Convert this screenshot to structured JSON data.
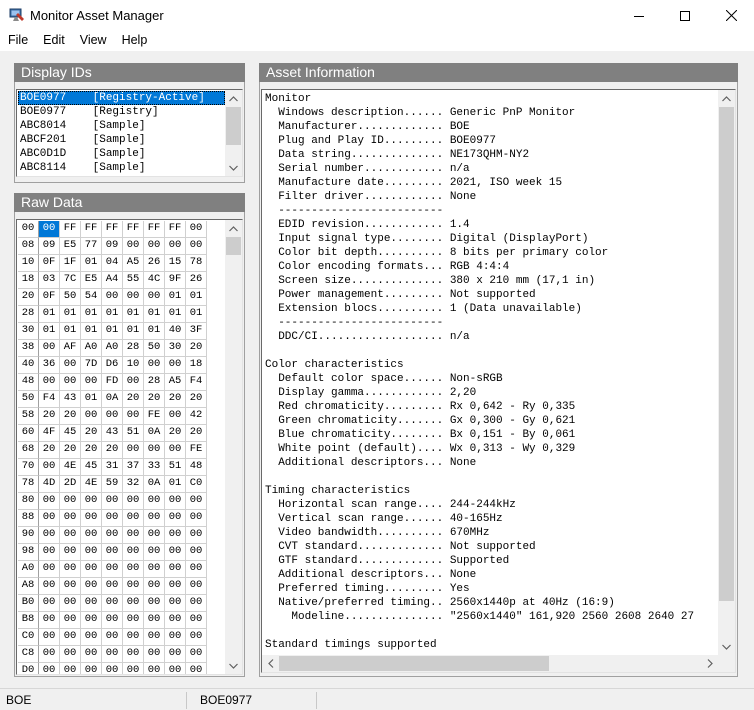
{
  "window": {
    "title": "Monitor Asset Manager",
    "icons": {
      "app": "monitor-app-icon",
      "minimize": "minimize-icon",
      "maximize": "maximize-icon",
      "close": "close-icon"
    }
  },
  "menu": [
    "File",
    "Edit",
    "View",
    "Help"
  ],
  "display_ids": {
    "title": "Display IDs",
    "items": [
      "BOE0977    [Registry-Active]",
      "BOE0977    [Registry]",
      "ABC8014    [Sample]",
      "ABCF201    [Sample]",
      "ABC0D1D    [Sample]",
      "ABC8114    [Sample]"
    ],
    "selected_index": 0
  },
  "raw_data": {
    "title": "Raw Data",
    "header": [
      "00",
      "00",
      "FF",
      "FF",
      "FF",
      "FF",
      "FF",
      "FF",
      "00"
    ],
    "rows": [
      [
        "08",
        "09",
        "E5",
        "77",
        "09",
        "00",
        "00",
        "00",
        "00"
      ],
      [
        "10",
        "0F",
        "1F",
        "01",
        "04",
        "A5",
        "26",
        "15",
        "78"
      ],
      [
        "18",
        "03",
        "7C",
        "E5",
        "A4",
        "55",
        "4C",
        "9F",
        "26"
      ],
      [
        "20",
        "0F",
        "50",
        "54",
        "00",
        "00",
        "00",
        "01",
        "01"
      ],
      [
        "28",
        "01",
        "01",
        "01",
        "01",
        "01",
        "01",
        "01",
        "01"
      ],
      [
        "30",
        "01",
        "01",
        "01",
        "01",
        "01",
        "01",
        "40",
        "3F"
      ],
      [
        "38",
        "00",
        "AF",
        "A0",
        "A0",
        "28",
        "50",
        "30",
        "20"
      ],
      [
        "40",
        "36",
        "00",
        "7D",
        "D6",
        "10",
        "00",
        "00",
        "18"
      ],
      [
        "48",
        "00",
        "00",
        "00",
        "FD",
        "00",
        "28",
        "A5",
        "F4"
      ],
      [
        "50",
        "F4",
        "43",
        "01",
        "0A",
        "20",
        "20",
        "20",
        "20"
      ],
      [
        "58",
        "20",
        "20",
        "00",
        "00",
        "00",
        "FE",
        "00",
        "42"
      ],
      [
        "60",
        "4F",
        "45",
        "20",
        "43",
        "51",
        "0A",
        "20",
        "20"
      ],
      [
        "68",
        "20",
        "20",
        "20",
        "20",
        "00",
        "00",
        "00",
        "FE"
      ],
      [
        "70",
        "00",
        "4E",
        "45",
        "31",
        "37",
        "33",
        "51",
        "48"
      ],
      [
        "78",
        "4D",
        "2D",
        "4E",
        "59",
        "32",
        "0A",
        "01",
        "C0"
      ],
      [
        "80",
        "00",
        "00",
        "00",
        "00",
        "00",
        "00",
        "00",
        "00"
      ],
      [
        "88",
        "00",
        "00",
        "00",
        "00",
        "00",
        "00",
        "00",
        "00"
      ],
      [
        "90",
        "00",
        "00",
        "00",
        "00",
        "00",
        "00",
        "00",
        "00"
      ],
      [
        "98",
        "00",
        "00",
        "00",
        "00",
        "00",
        "00",
        "00",
        "00"
      ],
      [
        "A0",
        "00",
        "00",
        "00",
        "00",
        "00",
        "00",
        "00",
        "00"
      ],
      [
        "A8",
        "00",
        "00",
        "00",
        "00",
        "00",
        "00",
        "00",
        "00"
      ],
      [
        "B0",
        "00",
        "00",
        "00",
        "00",
        "00",
        "00",
        "00",
        "00"
      ],
      [
        "B8",
        "00",
        "00",
        "00",
        "00",
        "00",
        "00",
        "00",
        "00"
      ],
      [
        "C0",
        "00",
        "00",
        "00",
        "00",
        "00",
        "00",
        "00",
        "00"
      ],
      [
        "C8",
        "00",
        "00",
        "00",
        "00",
        "00",
        "00",
        "00",
        "00"
      ],
      [
        "D0",
        "00",
        "00",
        "00",
        "00",
        "00",
        "00",
        "00",
        "00"
      ]
    ]
  },
  "asset_info": {
    "title": "Asset Information",
    "lines": [
      "Monitor",
      "  Windows description...... Generic PnP Monitor",
      "  Manufacturer............. BOE",
      "  Plug and Play ID......... BOE0977",
      "  Data string.............. NE173QHM-NY2",
      "  Serial number............ n/a",
      "  Manufacture date......... 2021, ISO week 15",
      "  Filter driver............ None",
      "  -------------------------",
      "  EDID revision............ 1.4",
      "  Input signal type........ Digital (DisplayPort)",
      "  Color bit depth.......... 8 bits per primary color",
      "  Color encoding formats... RGB 4:4:4",
      "  Screen size.............. 380 x 210 mm (17,1 in)",
      "  Power management......... Not supported",
      "  Extension blocs.......... 1 (Data unavailable)",
      "  -------------------------",
      "  DDC/CI................... n/a",
      "",
      "Color characteristics",
      "  Default color space...... Non-sRGB",
      "  Display gamma............ 2,20",
      "  Red chromaticity......... Rx 0,642 - Ry 0,335",
      "  Green chromaticity....... Gx 0,300 - Gy 0,621",
      "  Blue chromaticity........ Bx 0,151 - By 0,061",
      "  White point (default).... Wx 0,313 - Wy 0,329",
      "  Additional descriptors... None",
      "",
      "Timing characteristics",
      "  Horizontal scan range.... 244-244kHz",
      "  Vertical scan range...... 40-165Hz",
      "  Video bandwidth.......... 670MHz",
      "  CVT standard............. Not supported",
      "  GTF standard............. Supported",
      "  Additional descriptors... None",
      "  Preferred timing......... Yes",
      "  Native/preferred timing.. 2560x1440p at 40Hz (16:9)",
      "    Modeline............... \"2560x1440\" 161,920 2560 2608 2640 27",
      "",
      "Standard timings supported"
    ]
  },
  "status": {
    "manufacturer": "BOE",
    "pnp_id": "BOE0977"
  }
}
